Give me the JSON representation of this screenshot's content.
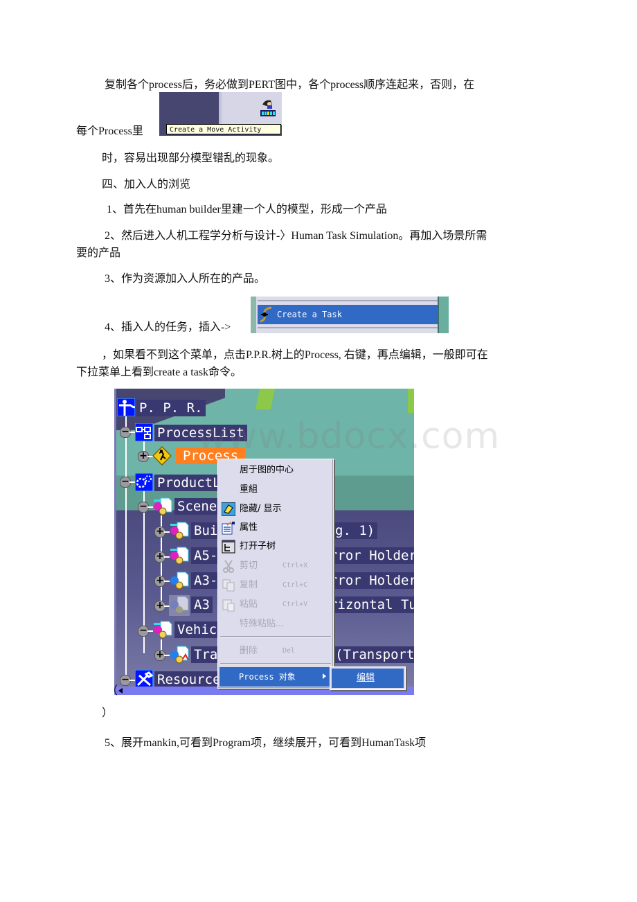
{
  "document": {
    "paragraphs": [
      "复制各个process后，务必做到PERT图中，各个process顺序连起来，否则，在",
      "每个Process里",
      "时，容易出现部分模型错乱的现象。",
      "四、加入人的浏览",
      "1、首先在human builder里建一个人的模型，形成一个产品",
      "2、然后进入人机工程学分析与设计-〉Human Task Simulation。再加入场景所需",
      "要的产品",
      "3、作为资源加入人所在的产品。",
      "4、插入人的任务，插入->",
      "，如果看不到这个菜单，点击P.P.R.树上的Process, 右键，再点编辑，一般即可在",
      "下拉菜单上看到create a task命令。",
      "（",
      "）",
      "5、展开mankin,可看到Program项，继续展开，可看到HumanTask项"
    ]
  },
  "screenshot_move_activity": {
    "tooltip": "Create a Move Activity",
    "icon": "move-activity-icon"
  },
  "screenshot_create_task": {
    "menu_item": "Create a Task",
    "icon": "task-icon",
    "highlight_color": "#316ac5"
  },
  "screenshot_tree": {
    "nodes": [
      {
        "label": "P. P. R.",
        "icon": "ppr-icon"
      },
      {
        "label": "ProcessList",
        "icon": "process-list-icon",
        "expander": "−"
      },
      {
        "label": "Process",
        "icon": "process-icon",
        "expander": "+",
        "selected": true
      },
      {
        "label": "ProductL",
        "icon": "product-list-icon",
        "expander": "−"
      },
      {
        "label": "Scene",
        "icon": "product-icon",
        "expander": "−"
      },
      {
        "label": "Bui",
        "suffix": "g. 1)",
        "icon": "product-icon",
        "expander": "+"
      },
      {
        "label": "A5-",
        "suffix": "rror Holder",
        "icon": "product-icon",
        "expander": "+"
      },
      {
        "label": "A3-",
        "suffix": "rror Holder",
        "icon": "product-icon",
        "expander": "+"
      },
      {
        "label": "A3",
        "suffix": "rizontal Tu",
        "icon": "product-hidden-icon",
        "expander": "+"
      },
      {
        "label": "Vehicl",
        "icon": "product-icon",
        "expander": "−"
      },
      {
        "label": "Tra",
        "suffix": " (Transport",
        "icon": "product-icon",
        "expander": "+"
      },
      {
        "label": "Resource",
        "icon": "resource-icon",
        "expander": "−"
      }
    ],
    "context_menu": [
      {
        "label": "居于图的中心",
        "enabled": true
      },
      {
        "label": "重組",
        "enabled": true
      },
      {
        "label": "隐藏/ 显示",
        "icon": "hide-show-icon",
        "enabled": true
      },
      {
        "label": "属性",
        "icon": "properties-icon",
        "enabled": true
      },
      {
        "label": "打开子树",
        "icon": "open-subtree-icon",
        "enabled": true
      },
      {
        "label": "剪切",
        "shortcut": "Ctrl+X",
        "icon": "cut-icon",
        "enabled": false
      },
      {
        "label": "复制",
        "shortcut": "Ctrl+C",
        "icon": "copy-icon",
        "enabled": false
      },
      {
        "label": "粘贴",
        "shortcut": "Ctrl+V",
        "icon": "paste-icon",
        "enabled": false
      },
      {
        "label": "特殊粘贴...",
        "enabled": false
      },
      {
        "label": "删除",
        "shortcut": "Del",
        "enabled": false
      },
      {
        "label": "Process 对象",
        "enabled": true,
        "highlighted": true,
        "submenu": true
      }
    ],
    "submenu": [
      {
        "label": "编辑",
        "highlighted": true
      }
    ],
    "selected_color": "#ff7f1e"
  },
  "watermark": "www.bdocx.com"
}
